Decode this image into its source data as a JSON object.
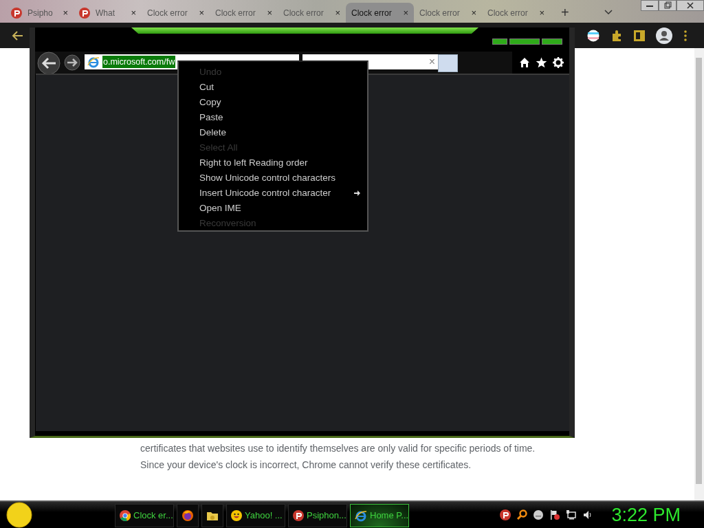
{
  "tabs": [
    {
      "label": "Psipho",
      "kind": "psiphon",
      "selected": false
    },
    {
      "label": "What",
      "kind": "psiphon",
      "selected": false
    },
    {
      "label": "Clock error",
      "selected": false
    },
    {
      "label": "Clock error",
      "selected": false
    },
    {
      "label": "Clock error",
      "selected": false
    },
    {
      "label": "Clock error",
      "selected": true
    },
    {
      "label": "Clock error",
      "selected": false
    },
    {
      "label": "Clock error",
      "selected": false
    }
  ],
  "tab_close": "×",
  "new_tab": "+",
  "page": {
    "paragraph": "certificates that websites use to identify themselves are only valid for specific periods of time. Since your device's clock is incorrect, Chrome cannot verify these certificates."
  },
  "ie_window": {
    "address": "o.microsoft.com/fw",
    "search_clear": "×"
  },
  "context_menu": {
    "items": [
      {
        "label": "Undo",
        "disabled": true,
        "submenu": false
      },
      {
        "label": "Cut",
        "disabled": false,
        "submenu": false
      },
      {
        "label": "Copy",
        "disabled": false,
        "submenu": false
      },
      {
        "label": "Paste",
        "disabled": false,
        "submenu": false
      },
      {
        "label": "Delete",
        "disabled": false,
        "submenu": false
      },
      {
        "label": "Select All",
        "disabled": true,
        "submenu": false
      },
      {
        "label": "Right to left Reading order",
        "disabled": false,
        "submenu": false
      },
      {
        "label": "Show Unicode control characters",
        "disabled": false,
        "submenu": false
      },
      {
        "label": "Insert Unicode control character",
        "disabled": false,
        "submenu": true
      },
      {
        "label": "Open IME",
        "disabled": false,
        "submenu": false
      },
      {
        "label": "Reconversion",
        "disabled": true,
        "submenu": false
      }
    ]
  },
  "taskbar": {
    "buttons": [
      {
        "label": "Clock er...",
        "kind": "chrome",
        "selected": false
      },
      {
        "kind": "firefox",
        "selected": false
      },
      {
        "kind": "folder",
        "selected": false
      },
      {
        "label": "Yahoo! ...",
        "kind": "yahoo",
        "selected": false
      },
      {
        "label": "Psiphon...",
        "kind": "psiphon",
        "selected": false
      },
      {
        "label": "Home P...",
        "kind": "ie",
        "selected": true
      }
    ],
    "clock": "3:22 PM"
  }
}
